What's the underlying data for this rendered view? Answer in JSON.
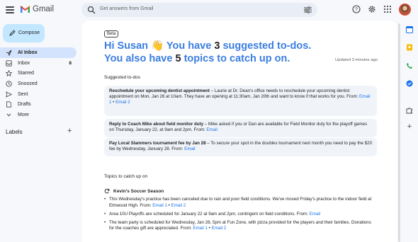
{
  "app": {
    "name": "Gmail"
  },
  "search": {
    "placeholder": "Get answers from Gmail"
  },
  "compose": {
    "label": "Compose"
  },
  "nav": {
    "items": [
      {
        "label": "AI Inbox",
        "count": "",
        "icon": "ai-inbox-icon",
        "active": true
      },
      {
        "label": "Inbox",
        "count": "8",
        "icon": "inbox-icon",
        "active": false
      },
      {
        "label": "Starred",
        "count": "",
        "icon": "star-icon",
        "active": false
      },
      {
        "label": "Snoozed",
        "count": "",
        "icon": "clock-icon",
        "active": false
      },
      {
        "label": "Sent",
        "count": "",
        "icon": "send-icon",
        "active": false
      },
      {
        "label": "Drafts",
        "count": "",
        "icon": "draft-icon",
        "active": false
      },
      {
        "label": "More",
        "count": "",
        "icon": "chevron-down-icon",
        "active": false
      }
    ],
    "labels_heading": "Labels"
  },
  "main": {
    "badge": "Beta",
    "greeting": {
      "hi": "Hi Susan",
      "wave": "👋",
      "text1": "You have",
      "todo_count": "3",
      "text2": "suggested to-dos.",
      "text3": "You also have",
      "topic_count": "5",
      "text4": "topics to catch up on."
    },
    "updated": "Updated 3 minutes ago",
    "todos_heading": "Suggested to-dos",
    "todos": [
      {
        "title": "Reschedule your upcoming dentist appointment",
        "body": " – Laurie at Dr. Dean's office needs to reschedule your upcoming dentist appointment on Mon, Jan 26 at 10am. They have an opening at 11:30am, Jan 20th and want to know if that works for you.",
        "from_label": "From:",
        "links": [
          "Email 1",
          "Email 2"
        ]
      },
      {
        "title": "Reply to Coach Mike about field monitor duty",
        "body": " – Mike asked if you or Dan are available for Field Monitor duty for the playoff games on Thursday, January 22, at 9am and 2pm.",
        "from_label": "From:",
        "links": [
          "Email"
        ]
      },
      {
        "title": "Pay Local Slammers tournament fee by Jan 28",
        "body": " – To secure your spot in the doubles tournament next month you need to pay the $20 fee by Wednesday, January 28.",
        "from_label": "From:",
        "links": [
          "Email"
        ]
      }
    ],
    "topics_heading": "Topics to catch up on",
    "topic": {
      "title": "Kevin's Soccer Season",
      "bullets": [
        {
          "text": "This Wednesday's practice has been canceled due to rain and poor field conditions. We've moved Friday's practice to the indoor field at Elmwood High.",
          "from_label": "From:",
          "links": [
            "Email 1",
            "Email 2"
          ]
        },
        {
          "text": "Area 10U Playoffs are scheduled for January 22 at 9am and 2pm, contingent on field conditions.",
          "from_label": "From:",
          "links": [
            "Email"
          ]
        },
        {
          "text": "The team party is scheduled for Wednesday, Jan 28, 5pm at Fun Zone, with pizza provided for the players and their families. Donations for the coaches gift are appreciated.",
          "from_label": "From:",
          "links": [
            "Email 1",
            "Email 2"
          ]
        }
      ]
    }
  },
  "colors": {
    "accent": "#3b7ee0",
    "link": "#1a73e8",
    "compose_bg": "#c2e7ff",
    "active_nav": "#d3e3fd",
    "card_bg": "#f0f4f9"
  }
}
